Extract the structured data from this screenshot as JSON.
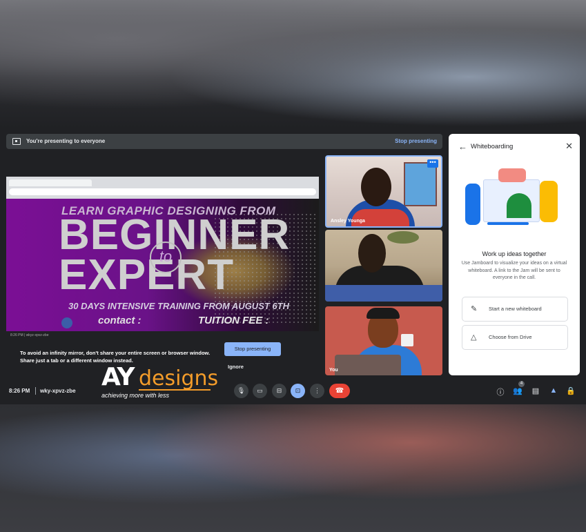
{
  "banner": {
    "text": "You're presenting to everyone",
    "stop_label": "Stop presenting"
  },
  "shared_screen": {
    "poster": {
      "headline": "LEARN GRAPHIC DESIGNING FROM",
      "big_line1": "BEGINNER",
      "connector": "to",
      "big_line2": "EXPERT",
      "subline": "30 DAYS INTENSIVE TRAINING FROM AUGUST 6TH",
      "contact": "contact :",
      "tuition": "TUITION FEE :"
    },
    "mini_bar_text": "8:26 PM  |  wkyz-xpvz-zbe"
  },
  "warning": {
    "line1": "To avoid an infinity mirror, don't share your entire screen or browser window.",
    "line2": "Share just a tab or a different window instead."
  },
  "stop_button_label": "Stop presenting",
  "ignore_label": "Ignore",
  "tiles": [
    {
      "name": "Ansley Younga",
      "more_icon": "more-horiz-icon"
    },
    {
      "name": ""
    },
    {
      "name": "You"
    }
  ],
  "panel": {
    "title": "Whiteboarding",
    "heading": "Work up ideas together",
    "description": "Use Jamboard to visualize your ideas on a virtual whiteboard. A link to the Jam will be sent to everyone in the call.",
    "options": [
      {
        "label": "Start a new whiteboard",
        "icon": "pencil-icon"
      },
      {
        "label": "Choose from Drive",
        "icon": "drive-icon"
      }
    ]
  },
  "bottom_bar": {
    "time": "8:26 PM",
    "meeting_code": "wky-xpvz-zbe",
    "people_count": "4",
    "colors": {
      "present_active": "#8ab4f8",
      "end_call": "#ea4335"
    }
  },
  "watermark": {
    "brand_a": "AY",
    "brand_b": "designs",
    "tagline": "achieving more with less"
  }
}
